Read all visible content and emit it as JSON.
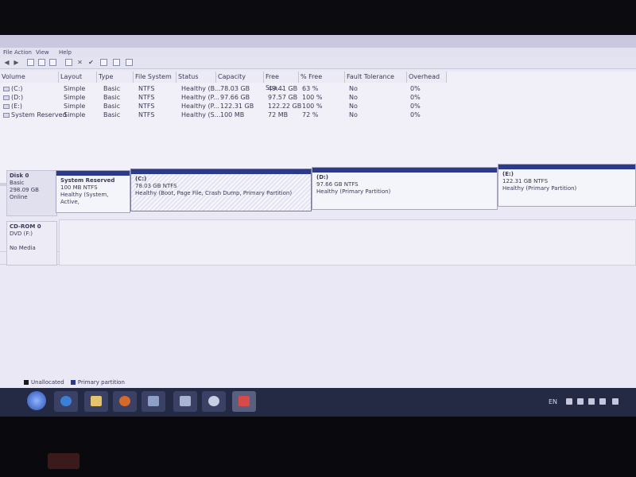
{
  "menu": {
    "items": [
      "File",
      "Action",
      "View",
      "Help"
    ]
  },
  "volumes": {
    "headers": [
      "Volume",
      "Layout",
      "Type",
      "File System",
      "Status",
      "Capacity",
      "Free Spa...",
      "% Free",
      "Fault Tolerance",
      "Overhead"
    ],
    "rows": [
      {
        "volume": "(C:)",
        "layout": "Simple",
        "type": "Basic",
        "fs": "NTFS",
        "status": "Healthy (B...",
        "capacity": "78.03 GB",
        "free": "49.41 GB",
        "pct": "63 %",
        "fault": "No",
        "overhead": "0%"
      },
      {
        "volume": "(D:)",
        "layout": "Simple",
        "type": "Basic",
        "fs": "NTFS",
        "status": "Healthy (P...",
        "capacity": "97.66 GB",
        "free": "97.57 GB",
        "pct": "100 %",
        "fault": "No",
        "overhead": "0%"
      },
      {
        "volume": "(E:)",
        "layout": "Simple",
        "type": "Basic",
        "fs": "NTFS",
        "status": "Healthy (P...",
        "capacity": "122.31 GB",
        "free": "122.22 GB",
        "pct": "100 %",
        "fault": "No",
        "overhead": "0%"
      },
      {
        "volume": "System Reserved",
        "layout": "Simple",
        "type": "Basic",
        "fs": "NTFS",
        "status": "Healthy (S...",
        "capacity": "100 MB",
        "free": "72 MB",
        "pct": "72 %",
        "fault": "No",
        "overhead": "0%"
      }
    ]
  },
  "disk0": {
    "name": "Disk 0",
    "type": "Basic",
    "size": "298.09 GB",
    "state": "Online",
    "partitions": [
      {
        "name": "System Reserved",
        "size": "100 MB NTFS",
        "status": "Healthy (System, Active,",
        "color": "#2b3a8a"
      },
      {
        "name": "(C:)",
        "size": "78.03 GB NTFS",
        "status": "Healthy (Boot, Page File, Crash Dump, Primary Partition)",
        "color": "#2b3a8a"
      },
      {
        "name": "(D:)",
        "size": "97.66 GB NTFS",
        "status": "Healthy (Primary Partition)",
        "color": "#2b3a8a"
      },
      {
        "name": "(E:)",
        "size": "122.31 GB NTFS",
        "status": "Healthy (Primary Partition)",
        "color": "#2b3a8a"
      }
    ]
  },
  "cdrom": {
    "name": "CD-ROM 0",
    "type": "DVD (F:)",
    "media": "No Media"
  },
  "legend": {
    "unallocated": "Unallocated",
    "primary": "Primary partition",
    "unallocated_color": "#1a1a1a",
    "primary_color": "#2b3a8a"
  },
  "tray": {
    "lang": "EN"
  },
  "icons": [
    "back-icon",
    "forward-icon",
    "properties-icon",
    "help-icon",
    "delete-icon",
    "check-icon",
    "open-icon",
    "explore-icon",
    "settings-icon"
  ]
}
